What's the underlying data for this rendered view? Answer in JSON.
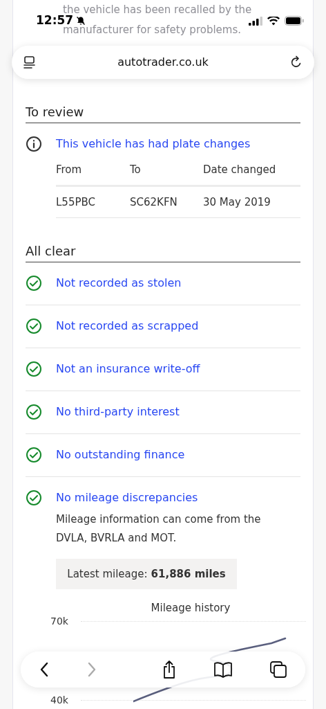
{
  "status_bar": {
    "time": "12:57",
    "silent": true
  },
  "address_bar": {
    "url": "autotrader.co.uk"
  },
  "recall_notice": {
    "lines": [
      "the vehicle has been recalled by the",
      "manufacturer for safety problems."
    ]
  },
  "to_review": {
    "heading": "To review",
    "item": {
      "title": "This vehicle has had plate changes",
      "columns": [
        "From",
        "To",
        "Date changed"
      ],
      "rows": [
        [
          "L55PBC",
          "SC62KFN",
          "30 May 2019"
        ]
      ]
    }
  },
  "all_clear": {
    "heading": "All clear",
    "items": [
      {
        "title": "Not recorded as stolen"
      },
      {
        "title": "Not recorded as scrapped"
      },
      {
        "title": "Not an insurance write-off"
      },
      {
        "title": "No third-party interest"
      },
      {
        "title": "No outstanding finance"
      },
      {
        "title": "No mileage discrepancies",
        "note": "Mileage information can come from the DVLA, BVRLA and MOT.",
        "latest_label": "Latest mileage:",
        "latest_value": "61,886 miles"
      }
    ]
  },
  "mileage_chart": {
    "title": "Mileage history",
    "axis_labels": [
      "70k",
      "40k"
    ]
  },
  "toolbar": {
    "back_disabled": false,
    "forward_disabled": true
  }
}
